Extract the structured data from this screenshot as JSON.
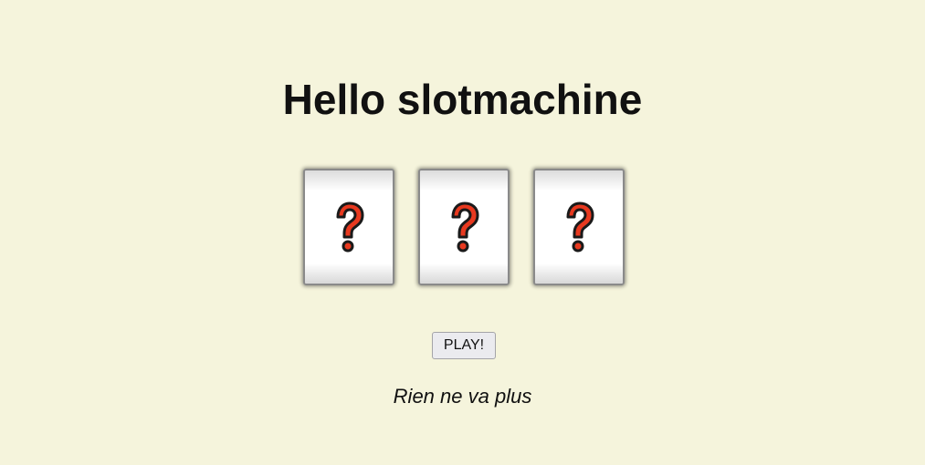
{
  "page": {
    "title": "Hello slotmachine",
    "background_color": "#f5f4dc"
  },
  "reels": [
    {
      "symbol": "question-mark",
      "icon_color": "#e8391f"
    },
    {
      "symbol": "question-mark",
      "icon_color": "#e8391f"
    },
    {
      "symbol": "question-mark",
      "icon_color": "#e8391f"
    }
  ],
  "controls": {
    "play_label": "PLAY!"
  },
  "status": {
    "message": "Rien ne va plus"
  }
}
